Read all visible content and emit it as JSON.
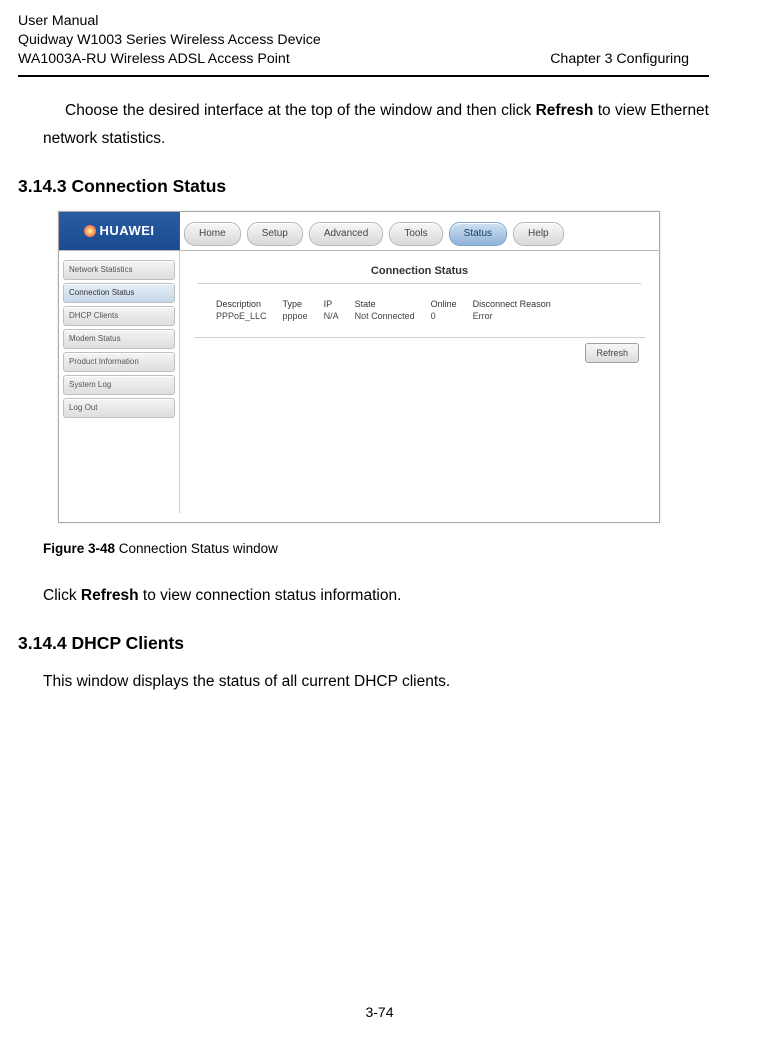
{
  "header": {
    "line1": "User Manual",
    "line2": "Quidway W1003 Series Wireless Access Device",
    "line3_left": "WA1003A-RU Wireless ADSL Access Point",
    "line3_right": "Chapter 3  Configuring"
  },
  "para1_a": "Choose the desired interface at the top of the window and then click ",
  "para1_b": "Refresh",
  "para1_c": " to view Ethernet network statistics.",
  "sec1_num": "3.14.3 ",
  "sec1_title": "Connection Status",
  "screenshot": {
    "brand": "HUAWEI",
    "tabs": [
      "Home",
      "Setup",
      "Advanced",
      "Tools",
      "Status",
      "Help"
    ],
    "active_tab_index": 4,
    "sidebar": [
      "Network Statistics",
      "Connection Status",
      "DHCP Clients",
      "Modem Status",
      "Product Information",
      "System Log",
      "Log Out"
    ],
    "active_sidebar_index": 1,
    "panel_title": "Connection Status",
    "table_headers": [
      "Description",
      "Type",
      "IP",
      "State",
      "Online",
      "Disconnect Reason"
    ],
    "table_row": [
      "PPPoE_LLC",
      "pppoe",
      "N/A",
      "Not Connected",
      "0",
      "Error"
    ],
    "refresh_label": "Refresh"
  },
  "fig_caption_bold": "Figure 3-48",
  "fig_caption_rest": " Connection Status window",
  "para2_a": "Click ",
  "para2_b": "Refresh",
  "para2_c": " to view connection status information.",
  "sec2_num": "3.14.4 ",
  "sec2_title": "DHCP Clients",
  "para3": "This window displays the status of all current DHCP clients.",
  "page_number": "3-74"
}
